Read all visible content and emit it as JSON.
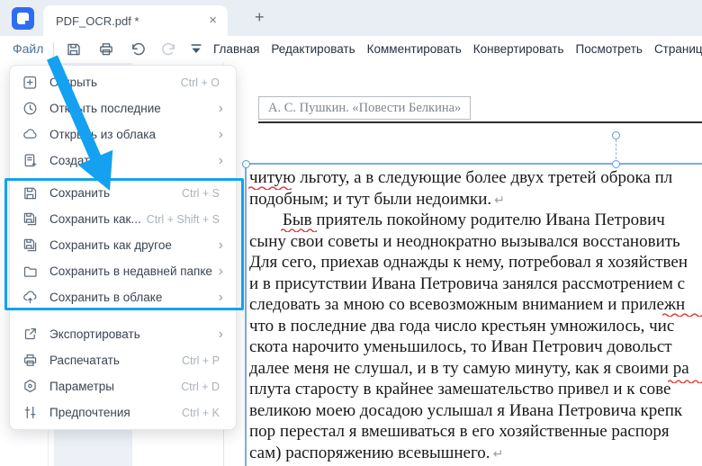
{
  "tab_bar": {
    "tab_title": "PDF_OCR.pdf *",
    "close_glyph": "×",
    "new_tab_glyph": "+"
  },
  "toolbar": {
    "file_label": "Файл",
    "ribbon_tabs": [
      "Главная",
      "Редактировать",
      "Комментировать",
      "Конвертировать",
      "Посмотреть",
      "Страница"
    ]
  },
  "file_menu": {
    "submenu_glyph": "›",
    "items": [
      {
        "icon": "open-file",
        "label": "Открыть",
        "shortcut": "Ctrl + O"
      },
      {
        "icon": "clock",
        "label": "Открыть последние",
        "submenu": true
      },
      {
        "icon": "cloud",
        "label": "Открыть из облака",
        "submenu": true
      },
      {
        "icon": "new-document",
        "label": "Создать",
        "submenu": true
      },
      {
        "icon": "save",
        "label": "Сохранить",
        "shortcut": "Ctrl + S"
      },
      {
        "icon": "save-as",
        "label": "Сохранить как...",
        "shortcut": "Ctrl + Shift + S"
      },
      {
        "icon": "save-as-other",
        "label": "Сохранить как другое",
        "submenu": true
      },
      {
        "icon": "folder",
        "label": "Сохранить в недавней папке",
        "submenu": true
      },
      {
        "icon": "cloud-upload",
        "label": "Сохранить в облаке",
        "submenu": true
      },
      {
        "icon": "export",
        "label": "Экспортировать",
        "submenu": true
      },
      {
        "icon": "printer",
        "label": "Распечатать",
        "shortcut": "Ctrl + P"
      },
      {
        "icon": "settings-hexagon",
        "label": "Параметры",
        "shortcut": "Ctrl + D"
      },
      {
        "icon": "sliders",
        "label": "Предпочтения",
        "shortcut": "Ctrl + K"
      }
    ]
  },
  "document": {
    "header": "А.  С.  Пушкин.  «Повести Белкина»",
    "para_mark": "↵",
    "lines": [
      "читую льготу, а в следующие более двух третей оброка пл",
      "подобным; и тут были недоимки.",
      "Быв приятель покойному родителю Ивана Петрович",
      "сыну свои советы и неоднократно вызывался восстановить",
      "Для сего, приехав однажды к нему, потребовал я хозяйствен",
      "и в присутствии Ивана Петровича занялся рассмотрением с",
      "следовать за мною со всевозможным вниманием и прилежн",
      "что в последние два года число крестьян умножилось, чис",
      "скота нарочито уменьшилось, то Иван Петрович довольст",
      "далее меня не слушал, и в ту самую минуту, как я своими ра",
      "плута старосту в крайнее замешательство привел и к сове",
      "великою моею досадою услышал я Ивана Петровича крепк",
      "пор перестал я вмешиваться в его хозяйственные распоря",
      "сам) распоряжению всевышнего."
    ]
  },
  "annotations": {
    "highlight_color": "#14a1f1",
    "arrow_color": "#14a1f1",
    "spell_underline_color": "#e23b3b",
    "selection_color": "#7dabe4"
  }
}
